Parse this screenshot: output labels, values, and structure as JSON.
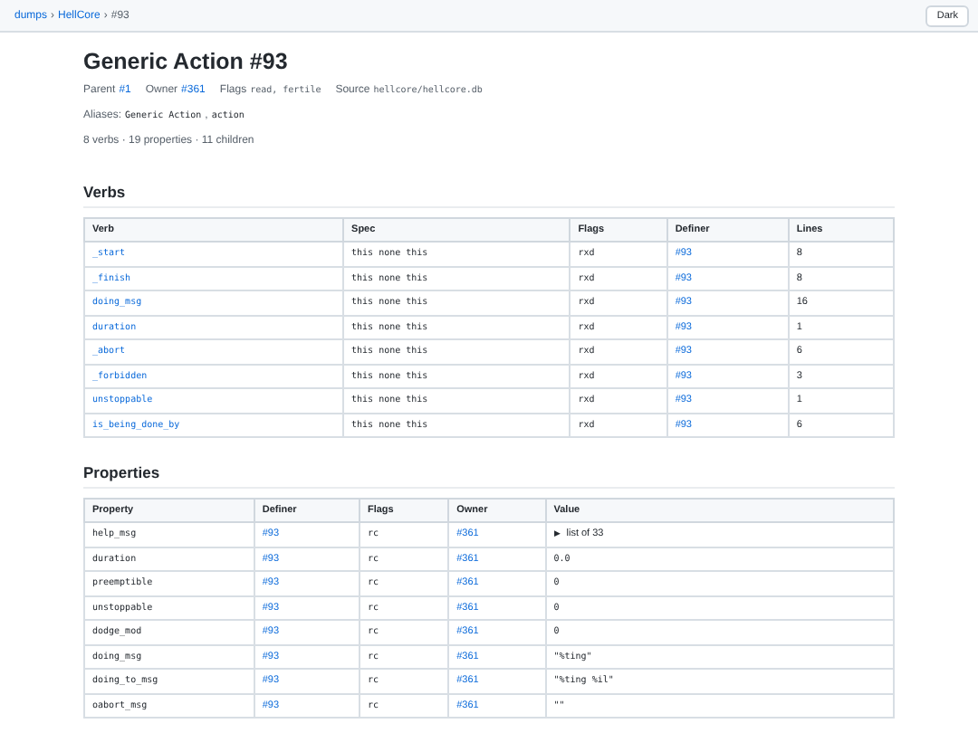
{
  "breadcrumb": [
    {
      "label": "dumps",
      "kind": "link"
    },
    {
      "label": "HellCore",
      "kind": "link"
    },
    {
      "label": "#93",
      "kind": "current"
    }
  ],
  "breadcrumb_separator": "›",
  "theme_button": "Dark",
  "title": "Generic Action #93",
  "meta": {
    "parent_label": "Parent",
    "parent": "#1",
    "owner_label": "Owner",
    "owner": "#361",
    "flags_label": "Flags",
    "flags": "read, fertile",
    "source_label": "Source",
    "source": "hellcore/hellcore.db"
  },
  "aliases": {
    "label": "Aliases:",
    "values": [
      "Generic Action",
      "action"
    ],
    "separator": ","
  },
  "summary": "8 verbs · 19 properties · 11 children",
  "verbs": {
    "heading": "Verbs",
    "columns": [
      "Verb",
      "Spec",
      "Flags",
      "Definer",
      "Lines"
    ],
    "rows": [
      [
        "_start",
        "this none this",
        "rxd",
        "#93",
        "8"
      ],
      [
        "_finish",
        "this none this",
        "rxd",
        "#93",
        "8"
      ],
      [
        "doing_msg",
        "this none this",
        "rxd",
        "#93",
        "16"
      ],
      [
        "duration",
        "this none this",
        "rxd",
        "#93",
        "1"
      ],
      [
        "_abort",
        "this none this",
        "rxd",
        "#93",
        "6"
      ],
      [
        "_forbidden",
        "this none this",
        "rxd",
        "#93",
        "3"
      ],
      [
        "unstoppable",
        "this none this",
        "rxd",
        "#93",
        "1"
      ],
      [
        "is_being_done_by",
        "this none this",
        "rxd",
        "#93",
        "6"
      ]
    ]
  },
  "properties": {
    "heading": "Properties",
    "columns": [
      "Property",
      "Definer",
      "Flags",
      "Owner",
      "Value"
    ],
    "rows": [
      {
        "name": "help_msg",
        "definer": "#93",
        "flags": "rc",
        "owner": "#361",
        "value": "list of 33",
        "kind": "list",
        "toggle": "▶"
      },
      {
        "name": "duration",
        "definer": "#93",
        "flags": "rc",
        "owner": "#361",
        "value": "0.0",
        "kind": "code"
      },
      {
        "name": "preemptible",
        "definer": "#93",
        "flags": "rc",
        "owner": "#361",
        "value": "0",
        "kind": "code"
      },
      {
        "name": "unstoppable",
        "definer": "#93",
        "flags": "rc",
        "owner": "#361",
        "value": "0",
        "kind": "code"
      },
      {
        "name": "dodge_mod",
        "definer": "#93",
        "flags": "rc",
        "owner": "#361",
        "value": "0",
        "kind": "code"
      },
      {
        "name": "doing_msg",
        "definer": "#93",
        "flags": "rc",
        "owner": "#361",
        "value": "\"%ting\"",
        "kind": "code"
      },
      {
        "name": "doing_to_msg",
        "definer": "#93",
        "flags": "rc",
        "owner": "#361",
        "value": "\"%ting %il\"",
        "kind": "code"
      },
      {
        "name": "oabort_msg",
        "definer": "#93",
        "flags": "rc",
        "owner": "#361",
        "value": "\"\"",
        "kind": "code"
      }
    ]
  }
}
